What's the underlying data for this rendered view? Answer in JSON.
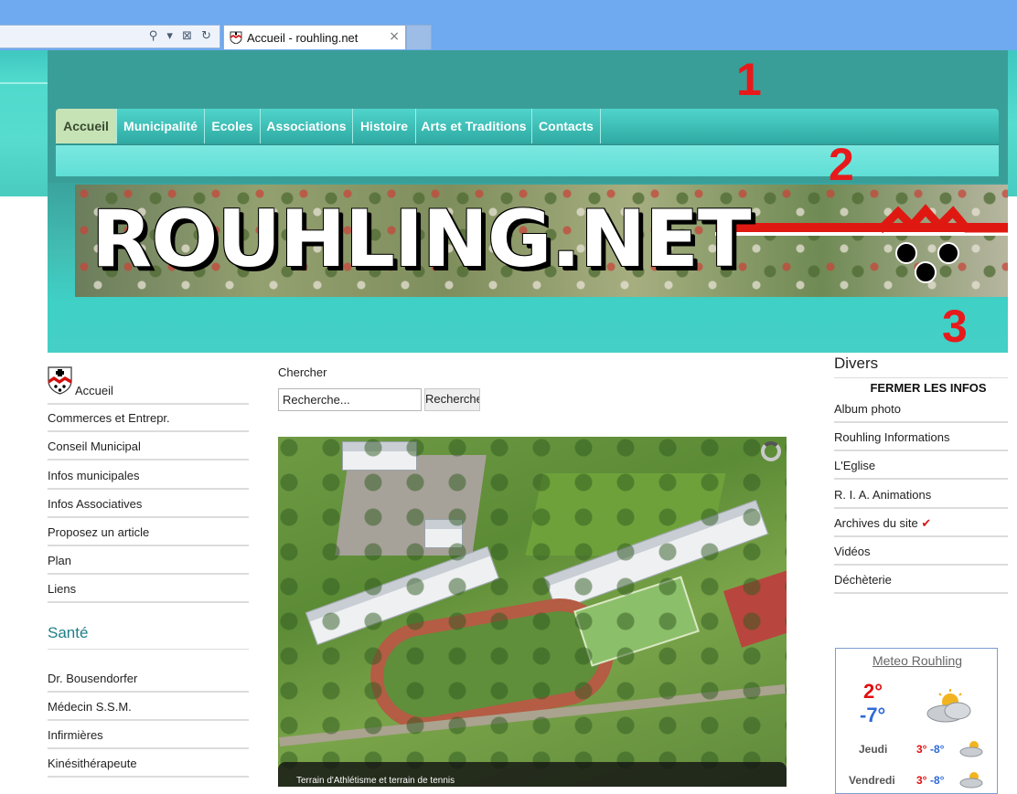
{
  "browser": {
    "tab_title": "Accueil - rouhling.net",
    "address_icons": "⚲ ▾ ⊠ ↻",
    "tab_close": "×"
  },
  "nav": {
    "items": [
      "Accueil",
      "Municipalité",
      "Ecoles",
      "Associations",
      "Histoire",
      "Arts et Traditions",
      "Contacts"
    ],
    "active": "Accueil"
  },
  "markers": [
    "1",
    "2",
    "3"
  ],
  "banner": {
    "title": "ROUHLING.NET"
  },
  "left_menu": {
    "home_label": "Accueil",
    "items": [
      "Commerces et Entrepr.",
      "Conseil Municipal",
      "Infos municipales",
      "Infos Associatives",
      "Proposez un article",
      "Plan",
      "Liens"
    ],
    "health_title": "Santé",
    "health_items": [
      "Dr. Bousendorfer",
      "Médecin S.S.M.",
      "Infirmières",
      "Kinésithérapeute"
    ]
  },
  "search": {
    "label": "Chercher",
    "value": "Recherche...",
    "button": "Rechercher"
  },
  "photo": {
    "caption": "Terrain d'Athlétisme et terrain de tennis"
  },
  "right_menu": {
    "title": "Divers",
    "close_label": "FERMER LES INFOS",
    "items": [
      "Album photo",
      "Rouhling Informations",
      "L'Eglise",
      "R. I. A. Animations",
      "Archives du site",
      "Vidéos",
      "Déchèterie"
    ],
    "archives_mark": "✔"
  },
  "meteo": {
    "title": "Meteo Rouhling",
    "today_high": "2°",
    "today_low": "-7°",
    "forecast": [
      {
        "day": "Jeudi",
        "high": "3°",
        "low": "-8°"
      },
      {
        "day": "Vendredi",
        "high": "3°",
        "low": "-8°"
      }
    ]
  },
  "colors": {
    "header_teal": "#3a9e98",
    "nav_active": "#c6e3b6",
    "marker_red": "#e8191b",
    "section_title": "#1f7f86"
  }
}
